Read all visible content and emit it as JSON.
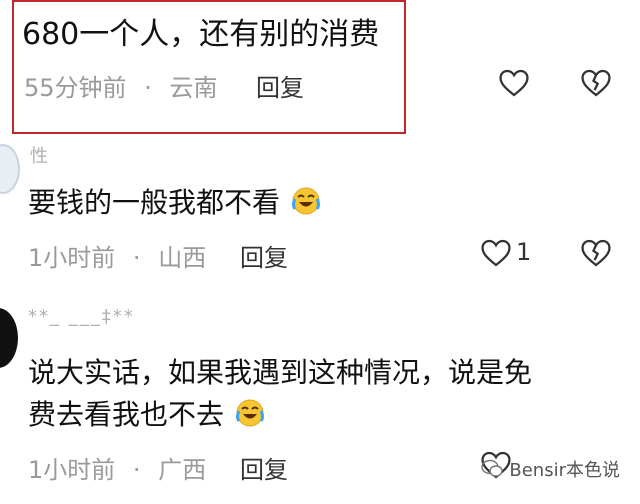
{
  "comments": [
    {
      "text": "680一个人，还有别的消费",
      "time": "55分钟前",
      "location": "云南",
      "reply_label": "回复",
      "like_count": ""
    },
    {
      "username": "性",
      "text": "要钱的一般我都不看",
      "time": "1小时前",
      "location": "山西",
      "reply_label": "回复",
      "like_count": "1"
    },
    {
      "username": "**_ ___‡**",
      "text_line1": "说大实话，如果我遇到这种情况，说是免",
      "text_line2": "费去看我也不去",
      "time": "1小时前",
      "location": "广西",
      "reply_label": "回复",
      "like_count": ""
    }
  ],
  "separator": "·",
  "watermark": {
    "text": "Bensir本色说"
  },
  "colors": {
    "highlight_border": "#c0282d",
    "meta_gray": "#9a9a9a"
  }
}
